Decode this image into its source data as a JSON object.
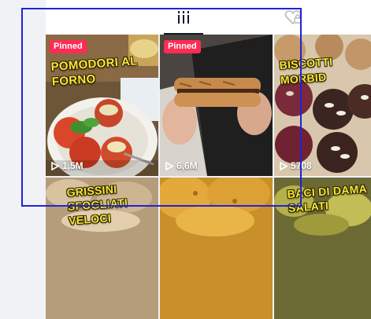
{
  "tabs": [
    {
      "name": "grid-tab",
      "icon": "grid-lines-icon",
      "active": true
    },
    {
      "name": "liked-tab",
      "icon": "heart-lock-icon",
      "active": false
    }
  ],
  "videos": [
    {
      "pinned_label": "Pinned",
      "caption": "POMODORI AL\nFORNO",
      "views": "1,5M"
    },
    {
      "pinned_label": "Pinned",
      "caption": "",
      "views": "6,6M"
    },
    {
      "pinned_label": "",
      "caption": "BISCOTTI MORBID",
      "views": "5708"
    },
    {
      "pinned_label": "",
      "caption": "GRISSINI\nSFOGLIATI\nVELOCI",
      "views": ""
    },
    {
      "pinned_label": "",
      "caption": "",
      "views": ""
    },
    {
      "pinned_label": "",
      "caption": "BACI DI DAMA\nSALATI",
      "views": ""
    }
  ],
  "colors": {
    "accent_pinned": "#fe2c55",
    "caption_yellow": "#f5e63a",
    "selection_border": "#1f23d6"
  }
}
